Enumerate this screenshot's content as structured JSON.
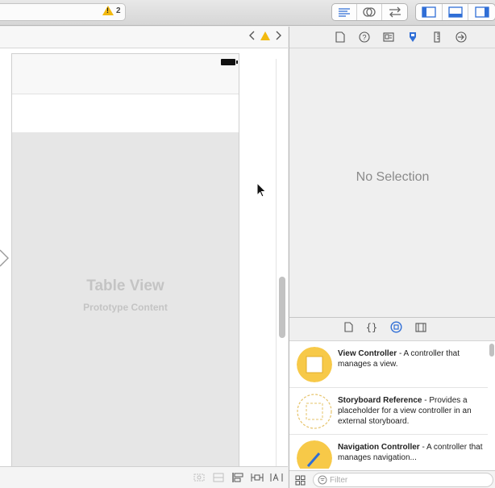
{
  "toolbar": {
    "warning_count": "2",
    "editor_modes": [
      "standard-editor-icon",
      "assistant-editor-icon",
      "version-editor-icon"
    ],
    "panel_toggles": [
      "navigator-toggle-icon",
      "debug-area-toggle-icon",
      "utilities-toggle-icon"
    ],
    "accent_color": "#2f6ed6",
    "warning_color": "#f2b90f"
  },
  "canvas": {
    "table_view_title": "Table View",
    "table_view_subtitle": "Prototype Content"
  },
  "inspector": {
    "empty_message": "No Selection",
    "tabs": [
      "file-inspector-icon",
      "help-icon",
      "identity-inspector-icon",
      "attributes-inspector-icon",
      "size-inspector-icon",
      "connections-inspector-icon"
    ]
  },
  "library": {
    "tabs": [
      "file-template-icon",
      "code-snippet-icon",
      "object-library-icon",
      "media-library-icon"
    ],
    "items": [
      {
        "name": "View Controller",
        "description": " - A controller that manages a view."
      },
      {
        "name": "Storyboard Reference",
        "description": " - Provides a placeholder for a view controller in an external storyboard."
      },
      {
        "name": "Navigation Controller",
        "description": " - A controller that manages navigation..."
      }
    ],
    "filter_placeholder": "Filter"
  }
}
